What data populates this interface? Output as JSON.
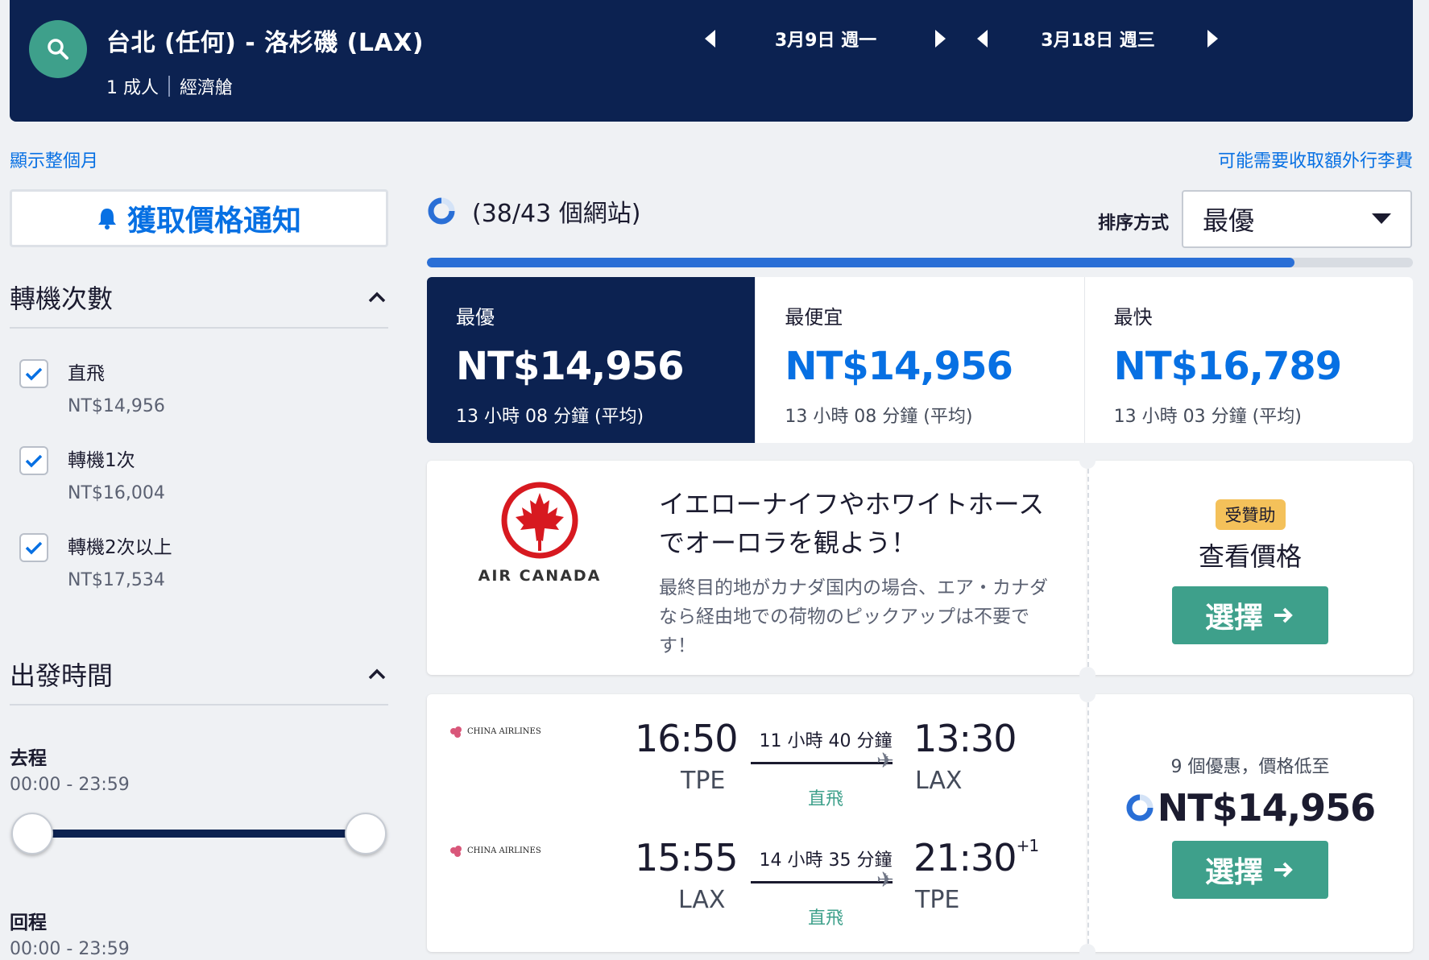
{
  "header": {
    "route": "台北 (任何) - 洛杉磯 (LAX)",
    "passengers": "1 成人",
    "cabin": "經濟艙",
    "depart_date": "3月9日 週一",
    "return_date": "3月18日 週三"
  },
  "links": {
    "show_month": "顯示整個月",
    "baggage_fee": "可能需要收取額外行李費"
  },
  "sidebar": {
    "alert_button": "獲取價格通知",
    "stops": {
      "title": "轉機次數",
      "options": [
        {
          "label": "直飛",
          "price": "NT$14,956",
          "checked": true
        },
        {
          "label": "轉機1次",
          "price": "NT$16,004",
          "checked": true
        },
        {
          "label": "轉機2次以上",
          "price": "NT$17,534",
          "checked": true
        }
      ]
    },
    "departure_time": {
      "title": "出發時間",
      "outbound_label": "去程",
      "outbound_range": "00:00 - 23:59",
      "return_label": "回程",
      "return_range": "00:00 - 23:59"
    }
  },
  "results": {
    "progress_text": "(38/43 個網站)",
    "progress_percent": 88,
    "sort_label": "排序方式",
    "sort_value": "最優",
    "tabs": [
      {
        "label": "最優",
        "price": "NT$14,956",
        "duration": "13 小時 08 分鐘 (平均)",
        "active": true
      },
      {
        "label": "最便宜",
        "price": "NT$14,956",
        "duration": "13 小時 08 分鐘 (平均)",
        "active": false
      },
      {
        "label": "最快",
        "price": "NT$16,789",
        "duration": "13 小時 03 分鐘 (平均)",
        "active": false
      }
    ]
  },
  "ad": {
    "logo_text": "AIR CANADA",
    "title": "イエローナイフやホワイトホースでオーロラを観よう！",
    "description": "最終目的地がカナダ国内の場合、エア・カナダなら経由地での荷物のピックアップは不要です！",
    "badge": "受贊助",
    "side_title": "查看價格",
    "button": "選擇"
  },
  "flight": {
    "airline": "CHINA AIRLINES",
    "outbound": {
      "depart_time": "16:50",
      "depart_code": "TPE",
      "duration": "11 小時 40 分鐘",
      "stops": "直飛",
      "arrive_time": "13:30",
      "arrive_code": "LAX",
      "day_offset": ""
    },
    "inbound": {
      "depart_time": "15:55",
      "depart_code": "LAX",
      "duration": "14 小時 35 分鐘",
      "stops": "直飛",
      "arrive_time": "21:30",
      "arrive_code": "TPE",
      "day_offset": "+1"
    },
    "deals_text": "9 個優惠，價格低至",
    "price": "NT$14,956",
    "button": "選擇"
  },
  "colors": {
    "navy": "#0c2251",
    "accent_blue": "#0770e3",
    "green": "#3ea08b",
    "badge_yellow": "#f4c15a"
  }
}
